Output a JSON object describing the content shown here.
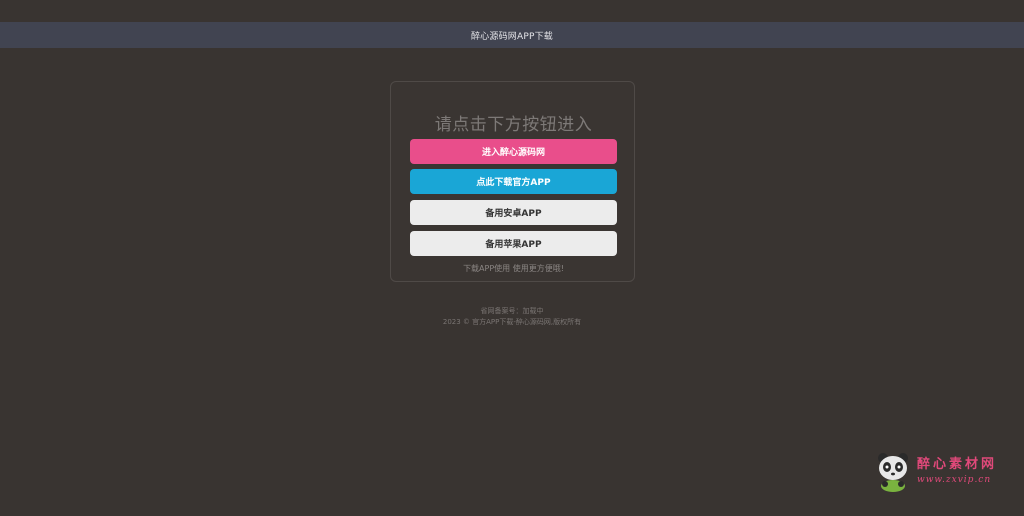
{
  "header": {
    "title": "醉心源码网APP下载"
  },
  "card": {
    "heading": "请点击下方按钮进入",
    "buttons": [
      {
        "label": "进入醉心源码网",
        "color": "#e94e8b"
      },
      {
        "label": "点此下载官方APP",
        "color": "#1aa6d6"
      },
      {
        "label": "备用安卓APP",
        "color": "#ececec"
      },
      {
        "label": "备用苹果APP",
        "color": "#ececec"
      }
    ],
    "note": "下载APP使用 使用更方便哦!"
  },
  "footer": {
    "icp": "省网备案号：加载中",
    "copyright": "2023 © 官方APP下载-醉心源码网,版权所有"
  },
  "watermark": {
    "text": "醉心素材网",
    "url": "www.zxvip.cn"
  },
  "colors": {
    "background": "#393431",
    "header_bar": "#414451",
    "accent_pink": "#e94e8b",
    "accent_blue": "#1aa6d6"
  }
}
